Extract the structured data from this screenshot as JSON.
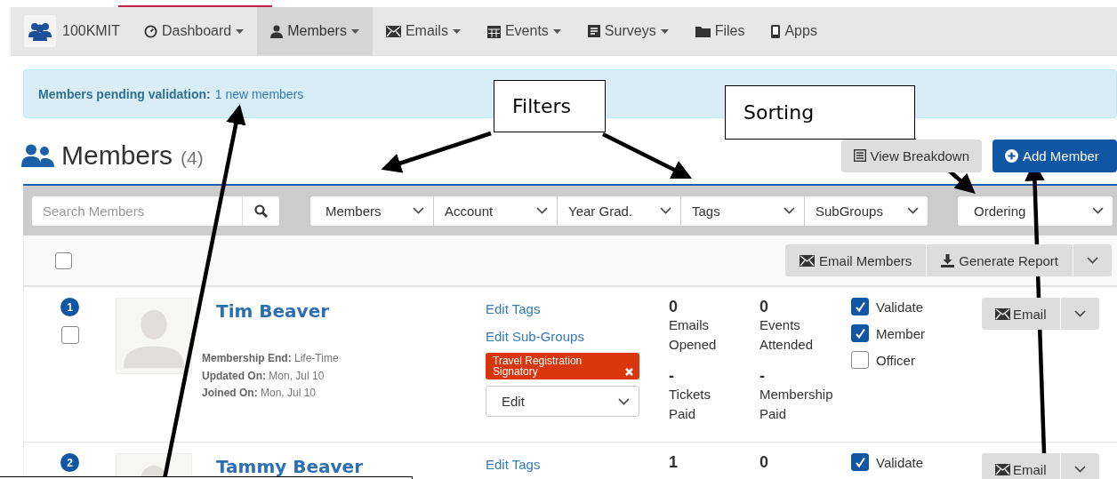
{
  "navbar": {
    "brand": "100KMIT",
    "items": [
      {
        "label": "Dashboard",
        "dropdown": true,
        "selected": false
      },
      {
        "label": "Members",
        "dropdown": true,
        "selected": true
      },
      {
        "label": "Emails",
        "dropdown": true,
        "selected": false
      },
      {
        "label": "Events",
        "dropdown": true,
        "selected": false
      },
      {
        "label": "Surveys",
        "dropdown": true,
        "selected": false
      },
      {
        "label": "Files",
        "dropdown": false,
        "selected": false
      },
      {
        "label": "Apps",
        "dropdown": false,
        "selected": false
      }
    ]
  },
  "alert": {
    "label": "Members pending validation:",
    "link": "1 new members"
  },
  "header": {
    "title": "Members",
    "count": "(4)",
    "buttons": [
      {
        "label": "View Breakdown",
        "kind": "default"
      },
      {
        "label": "Add Member",
        "kind": "primary"
      }
    ]
  },
  "filters": {
    "search": {
      "placeholder": "Search Members"
    },
    "selects": [
      "Members",
      "Account",
      "Year Grad.",
      "Tags",
      "SubGroups"
    ],
    "ordering": "Ordering"
  },
  "toolbar": {
    "select_all": {
      "checked": false
    },
    "buttons": [
      "Email Members",
      "Generate Report"
    ]
  },
  "members": [
    {
      "number": "1",
      "checked": false,
      "name": "Tim Beaver",
      "details": [
        {
          "label": "Membership End:",
          "value": "Life-Time"
        },
        {
          "label": "Updated On:",
          "value": "Mon, Jul 10"
        },
        {
          "label": "Joined On:",
          "value": "Mon, Jul 10"
        }
      ],
      "links": [
        "Edit Tags",
        "Edit Sub-Groups"
      ],
      "tags": [
        "Travel Registration Signatory"
      ],
      "edit": "Edit",
      "stats": [
        {
          "value": "0",
          "label": "Emails Opened"
        },
        {
          "value": "0",
          "label": "Events Attended"
        },
        {
          "value": "-",
          "label": "Tickets Paid"
        },
        {
          "value": "-",
          "label": "Membership Paid"
        }
      ],
      "roles": [
        {
          "label": "Validate",
          "checked": true
        },
        {
          "label": "Member",
          "checked": true
        },
        {
          "label": "Officer",
          "checked": false
        }
      ],
      "action": "Email"
    },
    {
      "number": "2",
      "name": "Tammy Beaver",
      "links": [
        "Edit Tags"
      ],
      "stats": [
        {
          "value": "1"
        },
        {
          "value": "0"
        }
      ],
      "roles": [
        {
          "label": "Validate",
          "checked": true
        }
      ],
      "action": "Email"
    }
  ],
  "annotations": [
    {
      "text": "Filters"
    },
    {
      "text": "Sorting"
    }
  ]
}
